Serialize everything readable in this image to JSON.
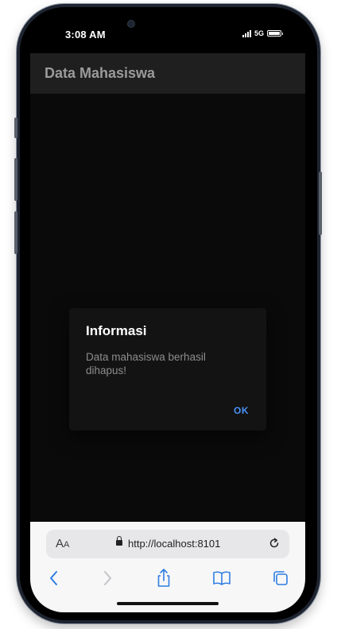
{
  "status_bar": {
    "time": "3:08 AM",
    "network": "5G",
    "battery_level": 1.0
  },
  "app": {
    "title": "Data Mahasiswa"
  },
  "alert": {
    "title": "Informasi",
    "message": "Data mahasiswa berhasil dihapus!",
    "ok_label": "OK"
  },
  "browser": {
    "text_size_label_large": "A",
    "text_size_label_small": "A",
    "url": "http://localhost:8101",
    "icons": [
      "text-size-icon",
      "lock-icon",
      "reload-icon",
      "back-icon",
      "forward-icon",
      "share-icon",
      "bookmarks-icon",
      "tabs-icon"
    ]
  },
  "colors": {
    "accent": "#4a8ff5",
    "safari_blue": "#2f7de1",
    "header_bg": "#1f1f1f",
    "content_bg": "#0a0a0a",
    "alert_bg": "#131313"
  }
}
